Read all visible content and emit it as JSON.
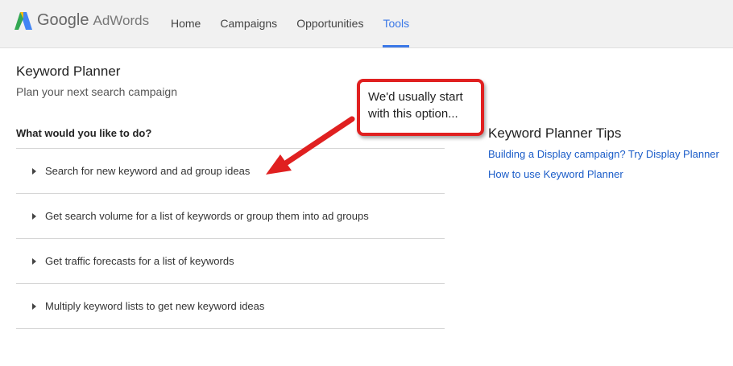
{
  "header": {
    "brand_google": "Google",
    "brand_product": "AdWords",
    "nav": [
      {
        "label": "Home"
      },
      {
        "label": "Campaigns"
      },
      {
        "label": "Opportunities"
      },
      {
        "label": "Tools"
      }
    ],
    "active_nav": "Tools",
    "accent_color": "#3b78e7"
  },
  "main": {
    "title": "Keyword Planner",
    "subtitle": "Plan your next search campaign",
    "question": "What would you like to do?",
    "options": [
      {
        "label": "Search for new keyword and ad group ideas"
      },
      {
        "label": "Get search volume for a list of keywords or group them into ad groups"
      },
      {
        "label": "Get traffic forecasts for a list of keywords"
      },
      {
        "label": "Multiply keyword lists to get new keyword ideas"
      }
    ]
  },
  "tips": {
    "title": "Keyword Planner Tips",
    "links": [
      {
        "label": "Building a Display campaign? Try Display Planner"
      },
      {
        "label": "How to use Keyword Planner"
      }
    ],
    "link_color": "#1a5cc8"
  },
  "annotation": {
    "text_line1": "We'd usually start",
    "text_line2": "with this option...",
    "color": "#e02020"
  }
}
